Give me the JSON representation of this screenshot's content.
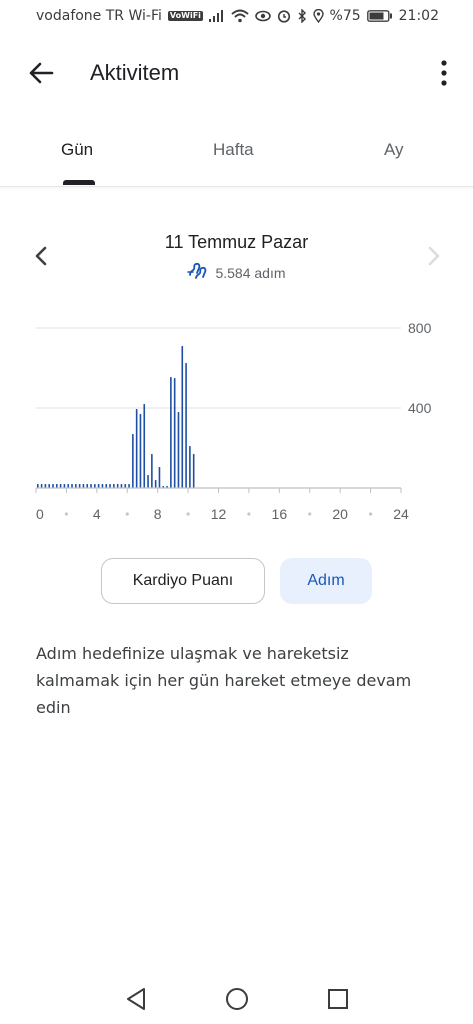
{
  "status_bar": {
    "carrier": "vodafone TR Wi-Fi",
    "volte_badge": "VoWiFi",
    "battery": "%75",
    "time": "21:02"
  },
  "app_bar": {
    "title": "Aktivitem"
  },
  "tabs": [
    {
      "label": "Gün",
      "active": true
    },
    {
      "label": "Hafta",
      "active": false
    },
    {
      "label": "Ay",
      "active": false
    }
  ],
  "date_nav": {
    "date": "11 Temmuz Pazar",
    "steps": "5.584 adım"
  },
  "toggle": {
    "cardio_label": "Kardiyo Puanı",
    "steps_label": "Adım",
    "selected": "Adım"
  },
  "tip_text": "Adım hedefinize ulaşmak ve hareketsiz kalmamak için her gün hareket etmeye devam edin",
  "colors": {
    "accent": "#1a56b8",
    "bar": "#1f4fa3",
    "selected_bg": "#e8f0fe"
  },
  "chart_data": {
    "type": "bar",
    "title": "",
    "xlabel": "",
    "ylabel": "",
    "x_ticks": [
      "0",
      "4",
      "8",
      "12",
      "16",
      "20",
      "24"
    ],
    "y_ticks": [
      "800",
      "400"
    ],
    "ylim": [
      0,
      800
    ],
    "grid": true,
    "unit_interval_minutes": 15,
    "series": [
      {
        "values": [
          20,
          20,
          20,
          20,
          20,
          20,
          20,
          20,
          20,
          20,
          20,
          20,
          20,
          20,
          20,
          20,
          20,
          20,
          20,
          20,
          20,
          20,
          20,
          20,
          20,
          270,
          395,
          370,
          420,
          65,
          170,
          40,
          105,
          10,
          10,
          555,
          550,
          380,
          710,
          625,
          210,
          170
        ]
      }
    ]
  }
}
